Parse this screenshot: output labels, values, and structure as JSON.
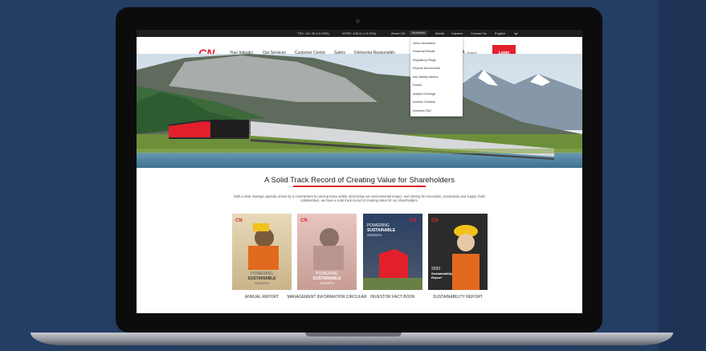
{
  "utility": {
    "tsx": "TSX: 141.30 (+0.29%)",
    "nyse": "NYSE: 106.11 (+0.15%)",
    "about": "About CN",
    "investors": "Investors",
    "media": "Media",
    "careers": "Careers",
    "contact": "Contact Us",
    "language": "English"
  },
  "nav": {
    "logo_text": "CN",
    "items": [
      "Your Industry",
      "Our Services",
      "Customer Centre",
      "Safety",
      "Delivering Responsibly"
    ],
    "search_placeholder": "Search",
    "login": "Login"
  },
  "dropdown": {
    "items": [
      "Stock Information",
      "Financial Results",
      "Regulatory Filings",
      "Reports and Archives",
      "Key Weekly Metrics",
      "Events",
      "Analyst Coverage",
      "Investor Contacts",
      "Investors FAQ"
    ]
  },
  "main": {
    "headline": "A Solid Track Record of Creating Value for Shareholders",
    "intro": "With a clear strategic agenda, driven by a commitment to running trains safely, minimizing our environmental impact, and striving for innovation, productivity and supply chain collaboration, we have a solid track record of creating value for our shareholders."
  },
  "cards": [
    {
      "caption": "ANNUAL REPORT",
      "logo": "CN",
      "cover_line1": "POWERING",
      "cover_line2": "SUSTAINABLE",
      "cover_line3": "GROWTH"
    },
    {
      "caption": "MANAGEMENT INFORMATION CIRCULAR",
      "logo": "CN",
      "cover_line1": "POWERING",
      "cover_line2": "SUSTAINABLE",
      "cover_line3": "GROWTH"
    },
    {
      "caption": "INVESTOR FACT BOOK",
      "logo": "CN",
      "cover_line1": "POWERING",
      "cover_line2": "SUSTAINABLE",
      "cover_line3": "GROWTH"
    },
    {
      "caption": "SUSTAINABILITY REPORT",
      "logo": "CN",
      "cover_line1": "2020",
      "cover_line2": "Sustainability",
      "cover_line3": "Report"
    }
  ],
  "colors": {
    "brand_red": "#e2202c",
    "background_navy": "#233d63",
    "topbar": "#1e1e1e"
  },
  "icons": {
    "search": "search-icon",
    "language": "chevron-down-icon"
  }
}
